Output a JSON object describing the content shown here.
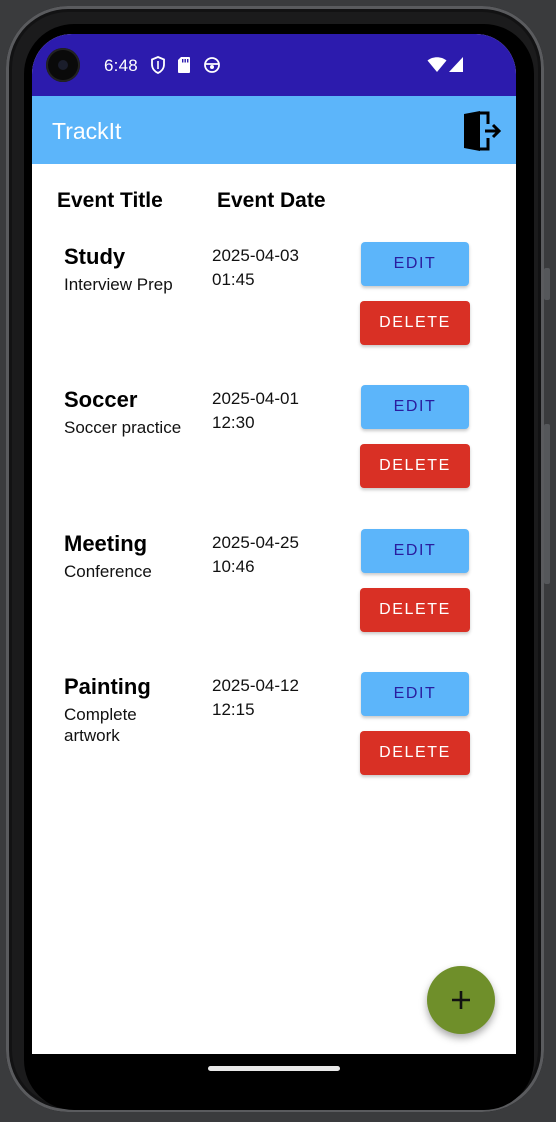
{
  "status_bar": {
    "time": "6:48",
    "icons_left": [
      "shield-icon",
      "sd-card-icon",
      "circle-status-icon"
    ],
    "icons_right": [
      "wifi-icon",
      "signal-icon"
    ]
  },
  "app_bar": {
    "title": "TrackIt",
    "logout_icon": "logout-door-icon",
    "color": "#5cb5fa"
  },
  "headers": {
    "title": "Event Title",
    "date": "Event Date"
  },
  "events": [
    {
      "title": "Study",
      "description": "Interview Prep",
      "date_line1": "2025-04-03",
      "date_line2": "01:45",
      "edit_label": "EDIT",
      "delete_label": "DELETE"
    },
    {
      "title": "Soccer",
      "description": "Soccer practice",
      "date_line1": "2025-04-01",
      "date_line2": "12:30",
      "edit_label": "EDIT",
      "delete_label": "DELETE"
    },
    {
      "title": "Meeting",
      "description": "Conference",
      "date_line1": "2025-04-25",
      "date_line2": "10:46",
      "edit_label": "EDIT",
      "delete_label": "DELETE"
    },
    {
      "title": "Painting",
      "description": "Complete artwork",
      "date_line1": "2025-04-12",
      "date_line2": "12:15",
      "edit_label": "EDIT",
      "delete_label": "DELETE"
    }
  ],
  "fab": {
    "icon": "plus-icon",
    "color": "#6f8f2a"
  },
  "colors": {
    "status_bar": "#2c1bad",
    "edit_button": "#5cb5fa",
    "edit_text": "#2a1d9e",
    "delete_button": "#d93025"
  }
}
